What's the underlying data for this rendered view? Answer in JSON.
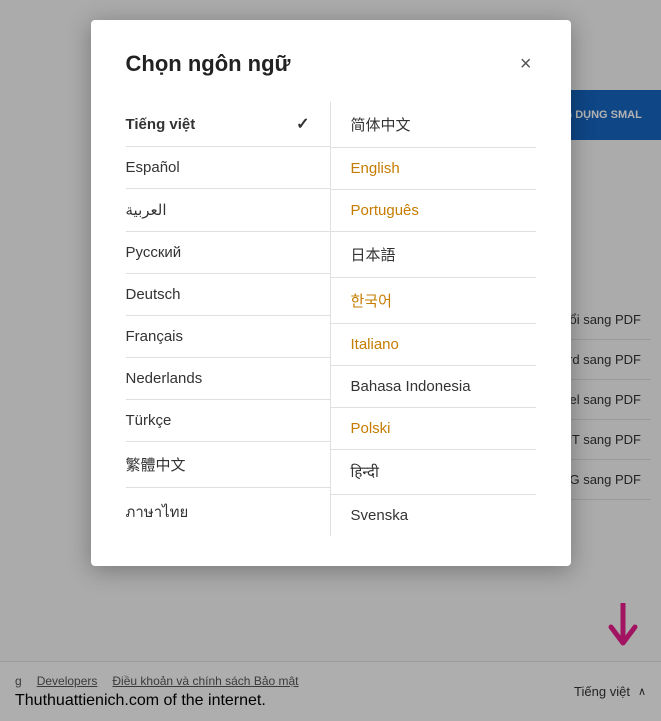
{
  "modal": {
    "title": "Chọn ngôn ngữ",
    "close_label": "×"
  },
  "languages": {
    "left_column": [
      {
        "id": "tieng-viet",
        "label": "Tiếng việt",
        "active": true
      },
      {
        "id": "espanol",
        "label": "Español",
        "active": false
      },
      {
        "id": "arabic",
        "label": "العربية",
        "active": false
      },
      {
        "id": "russian",
        "label": "Русский",
        "active": false
      },
      {
        "id": "deutsch",
        "label": "Deutsch",
        "active": false
      },
      {
        "id": "francais",
        "label": "Français",
        "active": false
      },
      {
        "id": "nederlands",
        "label": "Nederlands",
        "active": false
      },
      {
        "id": "turkce",
        "label": "Türkçe",
        "active": false
      },
      {
        "id": "traditional-chinese",
        "label": "繁體中文",
        "active": false
      },
      {
        "id": "thai",
        "label": "ภาษาไทย",
        "active": false
      }
    ],
    "right_column": [
      {
        "id": "simplified-chinese",
        "label": "简体中文",
        "active": false
      },
      {
        "id": "english",
        "label": "English",
        "active": false,
        "highlight": true
      },
      {
        "id": "portuguese",
        "label": "Português",
        "active": false,
        "highlight": true
      },
      {
        "id": "japanese",
        "label": "日本語",
        "active": false
      },
      {
        "id": "korean",
        "label": "한국어",
        "active": false,
        "highlight": true
      },
      {
        "id": "italiano",
        "label": "Italiano",
        "active": false,
        "highlight": true
      },
      {
        "id": "bahasa-indonesia",
        "label": "Bahasa Indonesia",
        "active": false
      },
      {
        "id": "polski",
        "label": "Polski",
        "active": false,
        "highlight": true
      },
      {
        "id": "hindi",
        "label": "हिन्दी",
        "active": false
      },
      {
        "id": "svenska",
        "label": "Svenska",
        "active": false
      }
    ]
  },
  "background": {
    "banner_text": "NG THỬ ỨNG DỤNG SMAL",
    "items": [
      "ến đổi sang PDF",
      "Word sang PDF",
      "Excel sang PDF",
      "PPT sang PDF",
      "JPG sang PDF"
    ]
  },
  "footer": {
    "links": [
      {
        "label": "g",
        "underline": false
      },
      {
        "label": "Developers",
        "underline": true
      },
      {
        "label": "Điều khoản và chính sách Bảo mật",
        "underline": true
      }
    ],
    "site": "Thuthuattienich.com",
    "site_sub": "of the internet.",
    "language_selector": "Tiếng việt",
    "chevron": "^"
  }
}
